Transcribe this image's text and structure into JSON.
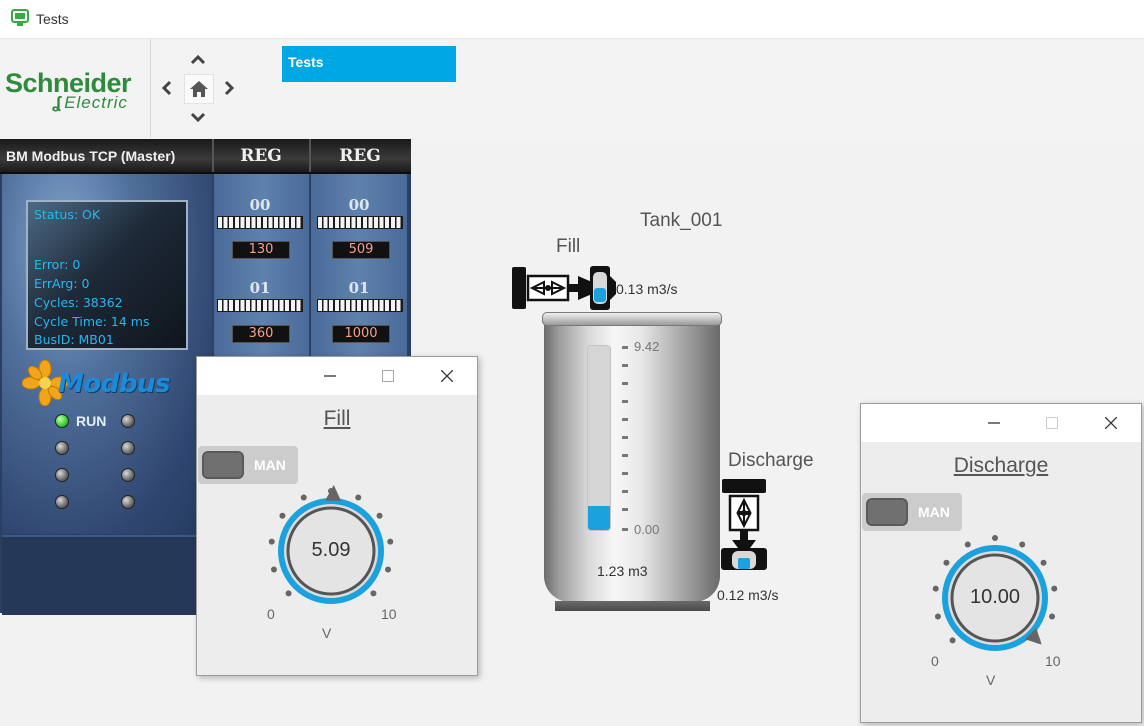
{
  "window": {
    "title": "Tests"
  },
  "brand": {
    "line1": "Schneider",
    "line2": "Electric"
  },
  "nav": {
    "active_tab": "Tests"
  },
  "modbus": {
    "header": "BM Modbus TCP (Master)",
    "reg_header": "REG",
    "status": {
      "status": "Status: OK",
      "error": "Error: 0",
      "errarg": "ErrArg: 0",
      "cycles": "Cycles: 38362",
      "cycle_time": "Cycle Time: 14 ms",
      "busid": "BusID: MB01"
    },
    "logo": "Modbus",
    "run_label": "RUN",
    "columns": [
      {
        "rows": [
          {
            "index": "00",
            "value": "130"
          },
          {
            "index": "01",
            "value": "360"
          }
        ]
      },
      {
        "rows": [
          {
            "index": "00",
            "value": "509"
          },
          {
            "index": "01",
            "value": "1000"
          }
        ]
      }
    ]
  },
  "tank": {
    "name": "Tank_001",
    "fill_label": "Fill",
    "fill_flow": "0.13 m3/s",
    "discharge_label": "Discharge",
    "discharge_flow": "0.12 m3/s",
    "scale_max": "9.42",
    "scale_min": "0.00",
    "volume": "1.23 m3",
    "level_fraction": 0.13,
    "accent_color": "#1ba1dd"
  },
  "fill_dialog": {
    "title": "Fill",
    "mode": "MAN",
    "value": "5.09",
    "min": "0",
    "max": "10",
    "unit": "V",
    "fraction": 0.509
  },
  "discharge_dialog": {
    "title": "Discharge",
    "mode": "MAN",
    "value": "10.00",
    "min": "0",
    "max": "10",
    "unit": "V",
    "fraction": 1.0
  }
}
